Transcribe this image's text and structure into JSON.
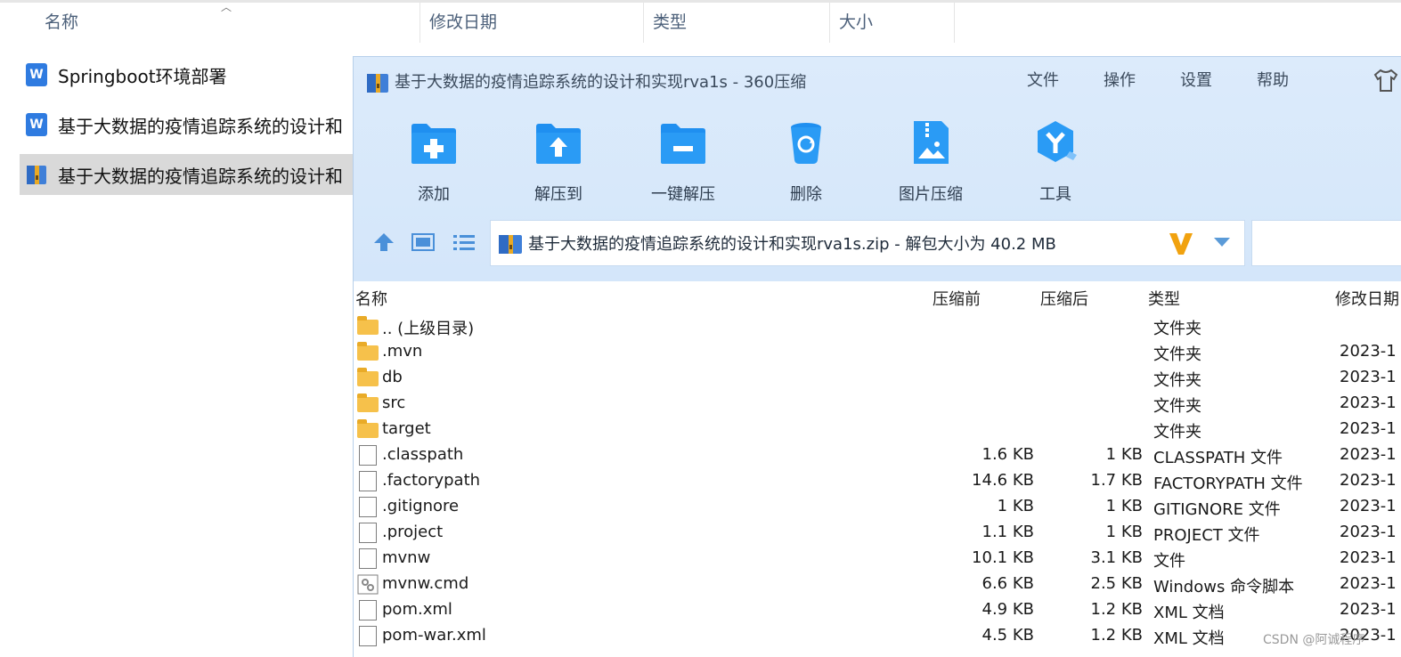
{
  "explorer": {
    "columns": [
      "名称",
      "修改日期",
      "类型",
      "大小"
    ],
    "files": [
      {
        "name": "Springboot环境部署",
        "icon": "word-doc-icon"
      },
      {
        "name": "基于大数据的疫情追踪系统的设计和",
        "icon": "word-doc-icon"
      },
      {
        "name": "基于大数据的疫情追踪系统的设计和",
        "icon": "zip-archive-icon",
        "selected": true
      }
    ]
  },
  "zip_window": {
    "title": "基于大数据的疫情追踪系统的设计和实现rva1s - 360压缩",
    "menu": [
      "文件",
      "操作",
      "设置",
      "帮助"
    ],
    "toolbar": [
      {
        "label": "添加",
        "icon": "add-folder-icon"
      },
      {
        "label": "解压到",
        "icon": "extract-to-icon"
      },
      {
        "label": "一键解压",
        "icon": "one-click-extract-icon"
      },
      {
        "label": "删除",
        "icon": "recycle-bin-icon"
      },
      {
        "label": "图片压缩",
        "icon": "image-compress-icon"
      },
      {
        "label": "工具",
        "icon": "tools-icon"
      }
    ],
    "path": "基于大数据的疫情追踪系统的设计和实现rva1s.zip - 解包大小为 40.2 MB",
    "columns": {
      "name": "名称",
      "before": "压缩前",
      "after": "压缩后",
      "type": "类型",
      "date": "修改日期"
    },
    "rows": [
      {
        "name": ".. (上级目录)",
        "before": "",
        "after": "",
        "type": "文件夹",
        "date": "",
        "icon": "folder"
      },
      {
        "name": ".mvn",
        "before": "",
        "after": "",
        "type": "文件夹",
        "date": "2023-1",
        "icon": "folder"
      },
      {
        "name": "db",
        "before": "",
        "after": "",
        "type": "文件夹",
        "date": "2023-1",
        "icon": "folder"
      },
      {
        "name": "src",
        "before": "",
        "after": "",
        "type": "文件夹",
        "date": "2023-1",
        "icon": "folder"
      },
      {
        "name": "target",
        "before": "",
        "after": "",
        "type": "文件夹",
        "date": "2023-1",
        "icon": "folder"
      },
      {
        "name": ".classpath",
        "before": "1.6 KB",
        "after": "1 KB",
        "type": "CLASSPATH 文件",
        "date": "2023-1",
        "icon": "file"
      },
      {
        "name": ".factorypath",
        "before": "14.6 KB",
        "after": "1.7 KB",
        "type": "FACTORYPATH 文件",
        "date": "2023-1",
        "icon": "file"
      },
      {
        "name": ".gitignore",
        "before": "1 KB",
        "after": "1 KB",
        "type": "GITIGNORE 文件",
        "date": "2023-1",
        "icon": "file"
      },
      {
        "name": ".project",
        "before": "1.1 KB",
        "after": "1 KB",
        "type": "PROJECT 文件",
        "date": "2023-1",
        "icon": "file"
      },
      {
        "name": "mvnw",
        "before": "10.1 KB",
        "after": "3.1 KB",
        "type": "文件",
        "date": "2023-1",
        "icon": "file"
      },
      {
        "name": "mvnw.cmd",
        "before": "6.6 KB",
        "after": "2.5 KB",
        "type": "Windows 命令脚本",
        "date": "2023-1",
        "icon": "cmd"
      },
      {
        "name": "pom.xml",
        "before": "4.9 KB",
        "after": "1.2 KB",
        "type": "XML 文档",
        "date": "2023-1",
        "icon": "file"
      },
      {
        "name": "pom-war.xml",
        "before": "4.5 KB",
        "after": "1.2 KB",
        "type": "XML 文档",
        "date": "2023-1",
        "icon": "file"
      }
    ]
  },
  "watermark": "CSDN @阿诚程序"
}
